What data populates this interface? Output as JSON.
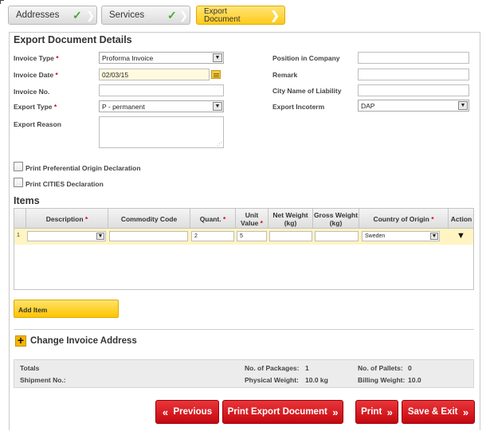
{
  "wizard": {
    "steps": [
      {
        "label": "Addresses",
        "done": true
      },
      {
        "label": "Services",
        "done": true
      },
      {
        "label": "Export Document",
        "done": false
      }
    ],
    "check_glyph": "✓",
    "arrow_glyph": "❯"
  },
  "form": {
    "title": "Export Document Details",
    "invoice_type_label": "Invoice Type",
    "invoice_type_value": "Proforma Invoice",
    "invoice_date_label": "Invoice Date",
    "invoice_date_value": "02/03/15",
    "invoice_no_label": "Invoice No.",
    "invoice_no_value": "",
    "export_type_label": "Export Type",
    "export_type_value": "P - permanent",
    "export_reason_label": "Export Reason",
    "export_reason_value": "",
    "position_label": "Position in Company",
    "position_value": "",
    "remark_label": "Remark",
    "remark_value": "",
    "city_liability_label": "City Name of Liability",
    "city_liability_value": "",
    "incoterm_label": "Export Incoterm",
    "incoterm_value": "DAP",
    "required_mark": "*",
    "print_pref_label": "Print Preferential Origin Declaration",
    "print_cites_label": "Print CITIES Declaration"
  },
  "items": {
    "heading": "Items",
    "columns": {
      "description": "Description",
      "commodity": "Commodity Code",
      "quant": "Quant.",
      "unit_value": "Unit Value",
      "net_weight": "Net Weight (kg)",
      "gross_weight": "Gross Weight (kg)",
      "country": "Country of Origin",
      "action": "Action"
    },
    "rows": [
      {
        "num": "1",
        "description": "",
        "commodity": "",
        "quant": "2",
        "unit_value": "5",
        "net_weight": "",
        "gross_weight": "",
        "country": "Sweden"
      }
    ],
    "action_glyph": "▼",
    "add_label": "Add Item"
  },
  "change_address": {
    "plus": "+",
    "label": "Change Invoice Address"
  },
  "totals": {
    "totals_label": "Totals",
    "shipment_label": "Shipment No.:",
    "packages_label": "No. of Packages:",
    "packages_value": "1",
    "physical_label": "Physical Weight:",
    "physical_value": "10.0 kg",
    "pallets_label": "No. of Pallets:",
    "pallets_value": "0",
    "billing_label": "Billing Weight:",
    "billing_value": "10.0"
  },
  "buttons": {
    "previous": "Previous",
    "print_export": "Print Export Document",
    "print": "Print",
    "save_exit": "Save & Exit",
    "back_glyph": "«",
    "fwd_glyph": "»"
  },
  "colors": {
    "accent_yellow": "#ffcb1a",
    "dhl_red": "#d40511",
    "check_green": "#46a82a"
  }
}
